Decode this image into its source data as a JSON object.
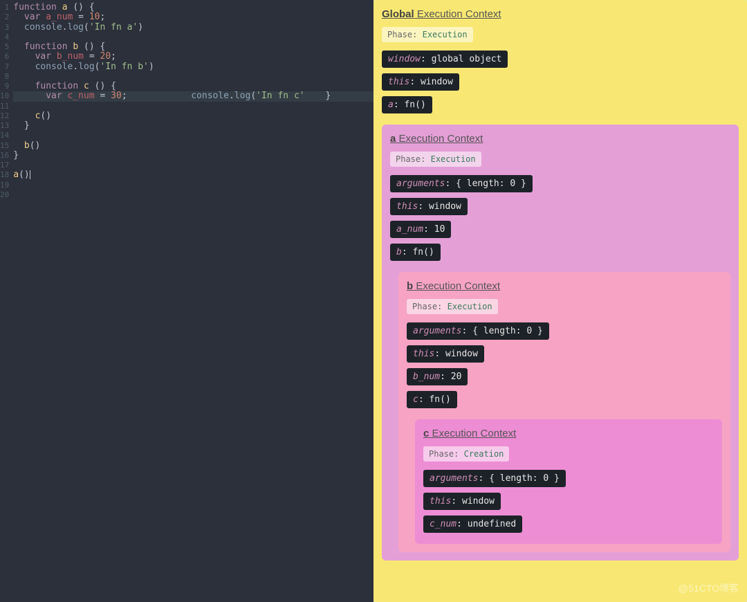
{
  "editor": {
    "lineCount": 20,
    "highlightedLines": [
      10,
      11,
      12
    ],
    "code": [
      {
        "n": 1,
        "t": [
          [
            "kw",
            "function"
          ],
          [
            "pun",
            " "
          ],
          [
            "fn",
            "a"
          ],
          [
            "pun",
            " () {"
          ]
        ]
      },
      {
        "n": 2,
        "t": [
          [
            "pun",
            "  "
          ],
          [
            "kw",
            "var"
          ],
          [
            "pun",
            " "
          ],
          [
            "var",
            "a_num"
          ],
          [
            "pun",
            " = "
          ],
          [
            "num",
            "10"
          ],
          [
            "pun",
            ";"
          ]
        ]
      },
      {
        "n": 3,
        "t": [
          [
            "pun",
            "  "
          ],
          [
            "obj",
            "console"
          ],
          [
            "pun",
            "."
          ],
          [
            "prop",
            "log"
          ],
          [
            "pun",
            "("
          ],
          [
            "str",
            "'In fn a'"
          ],
          [
            "pun",
            ")"
          ]
        ]
      },
      {
        "n": 4,
        "t": []
      },
      {
        "n": 5,
        "t": [
          [
            "pun",
            "  "
          ],
          [
            "kw",
            "function"
          ],
          [
            "pun",
            " "
          ],
          [
            "fn",
            "b"
          ],
          [
            "pun",
            " () {"
          ]
        ]
      },
      {
        "n": 6,
        "t": [
          [
            "pun",
            "    "
          ],
          [
            "kw",
            "var"
          ],
          [
            "pun",
            " "
          ],
          [
            "var",
            "b_num"
          ],
          [
            "pun",
            " = "
          ],
          [
            "num",
            "20"
          ],
          [
            "pun",
            ";"
          ]
        ]
      },
      {
        "n": 7,
        "t": [
          [
            "pun",
            "    "
          ],
          [
            "obj",
            "console"
          ],
          [
            "pun",
            "."
          ],
          [
            "prop",
            "log"
          ],
          [
            "pun",
            "("
          ],
          [
            "str",
            "'In fn b'"
          ],
          [
            "pun",
            ")"
          ]
        ]
      },
      {
        "n": 8,
        "t": []
      },
      {
        "n": 9,
        "t": [
          [
            "pun",
            "    "
          ],
          [
            "kw",
            "function"
          ],
          [
            "pun",
            " "
          ],
          [
            "fn",
            "c"
          ],
          [
            "pun",
            " () {"
          ]
        ]
      },
      {
        "n": 10,
        "t": [
          [
            "pun",
            "      "
          ],
          [
            "kw",
            "var"
          ],
          [
            "pun",
            " "
          ],
          [
            "var",
            "c_num"
          ],
          [
            "pun",
            " = "
          ],
          [
            "num",
            "30"
          ],
          [
            "pun",
            ";"
          ]
        ]
      },
      {
        "n": 11,
        "t": [
          [
            "pun",
            "      "
          ],
          [
            "obj",
            "console"
          ],
          [
            "pun",
            "."
          ],
          [
            "prop",
            "log"
          ],
          [
            "pun",
            "("
          ],
          [
            "str",
            "'In fn c'"
          ],
          [
            "pun",
            ")"
          ]
        ]
      },
      {
        "n": 12,
        "t": [
          [
            "pun",
            "    }"
          ]
        ]
      },
      {
        "n": 13,
        "t": []
      },
      {
        "n": 14,
        "t": [
          [
            "pun",
            "    "
          ],
          [
            "fn",
            "c"
          ],
          [
            "pun",
            "()"
          ]
        ]
      },
      {
        "n": 15,
        "t": [
          [
            "pun",
            "  }"
          ]
        ]
      },
      {
        "n": 16,
        "t": []
      },
      {
        "n": 17,
        "t": [
          [
            "pun",
            "  "
          ],
          [
            "fn",
            "b"
          ],
          [
            "pun",
            "()"
          ]
        ]
      },
      {
        "n": 18,
        "t": [
          [
            "pun",
            "}"
          ]
        ]
      },
      {
        "n": 19,
        "t": []
      },
      {
        "n": 20,
        "t": [
          [
            "fn",
            "a"
          ],
          [
            "pun",
            "()"
          ]
        ]
      }
    ]
  },
  "contexts": {
    "global": {
      "boldName": "Global",
      "title": " Execution Context",
      "phase": {
        "label": "Phase:",
        "value": "Execution"
      },
      "vars": [
        {
          "k": "window",
          "v": "global object"
        },
        {
          "k": "this",
          "v": "window"
        },
        {
          "k": "a",
          "v": "fn()"
        }
      ]
    },
    "a": {
      "boldName": "a",
      "title": " Execution Context",
      "phase": {
        "label": "Phase:",
        "value": "Execution"
      },
      "vars": [
        {
          "k": "arguments",
          "v": "{ length: 0 }"
        },
        {
          "k": "this",
          "v": "window"
        },
        {
          "k": "a_num",
          "v": "10"
        },
        {
          "k": "b",
          "v": "fn()"
        }
      ]
    },
    "b": {
      "boldName": "b",
      "title": " Execution Context",
      "phase": {
        "label": "Phase:",
        "value": "Execution"
      },
      "vars": [
        {
          "k": "arguments",
          "v": "{ length: 0 }"
        },
        {
          "k": "this",
          "v": "window"
        },
        {
          "k": "b_num",
          "v": "20"
        },
        {
          "k": "c",
          "v": "fn()"
        }
      ]
    },
    "c": {
      "boldName": "c",
      "title": " Execution Context",
      "phase": {
        "label": "Phase:",
        "value": "Creation"
      },
      "vars": [
        {
          "k": "arguments",
          "v": "{ length: 0 }"
        },
        {
          "k": "this",
          "v": "window"
        },
        {
          "k": "c_num",
          "v": "undefined"
        }
      ]
    }
  },
  "watermark": "@51CTO博客"
}
